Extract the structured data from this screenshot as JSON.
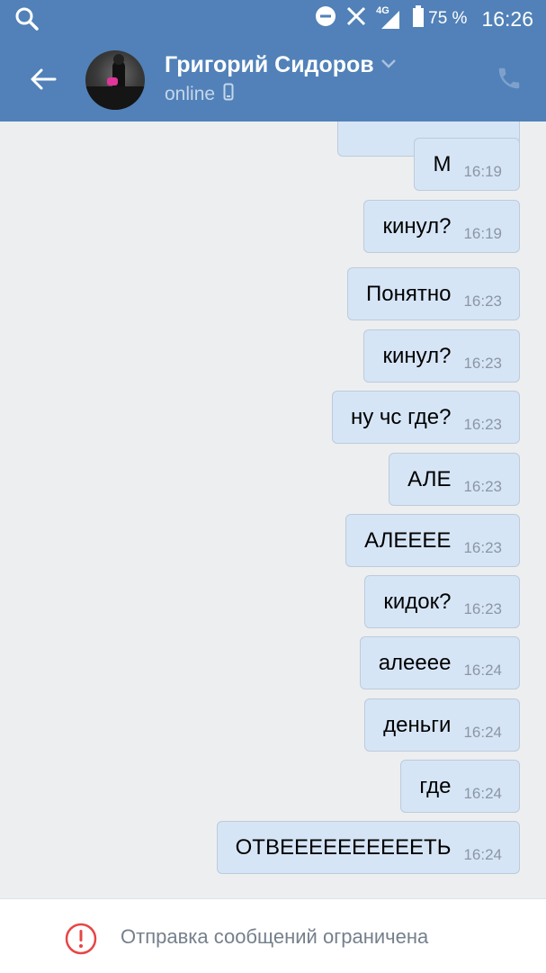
{
  "status_bar": {
    "network_label": "4G",
    "battery_percent_label": "75 %",
    "battery_level": 0.75,
    "time": "16:26"
  },
  "chat_header": {
    "contact_name": "Григорий Сидоров",
    "status": "online"
  },
  "messages": [
    {
      "text": "М",
      "time": "16:19"
    },
    {
      "text": "кинул?",
      "time": "16:19"
    },
    {
      "text": "Понятно",
      "time": "16:23"
    },
    {
      "text": "кинул?",
      "time": "16:23"
    },
    {
      "text": "ну чс где?",
      "time": "16:23"
    },
    {
      "text": "АЛЕ",
      "time": "16:23"
    },
    {
      "text": "АЛЕЕЕЕ",
      "time": "16:23"
    },
    {
      "text": "кидок?",
      "time": "16:23"
    },
    {
      "text": "алееее",
      "time": "16:24"
    },
    {
      "text": "деньги",
      "time": "16:24"
    },
    {
      "text": "где",
      "time": "16:24"
    },
    {
      "text": "ОТВЕЕЕЕЕЕЕЕЕЕТЬ",
      "time": "16:24"
    }
  ],
  "bottom_bar": {
    "restriction_text": "Отправка сообщений ограничена"
  },
  "colors": {
    "header_bg": "#5181b8",
    "chat_bg": "#edeef0",
    "outgoing_bubble": "#d6e5f6",
    "warning_red": "#e64646"
  },
  "icons": {
    "status_search": "search-icon",
    "dnd": "do-not-disturb-icon",
    "data_off": "x-icon",
    "signal": "signal-icon",
    "battery": "battery-icon",
    "back": "back-arrow-icon",
    "chevron": "chevron-down-icon",
    "mobile": "mobile-phone-icon",
    "call": "phone-call-icon",
    "warning": "exclamation-circle-icon"
  }
}
